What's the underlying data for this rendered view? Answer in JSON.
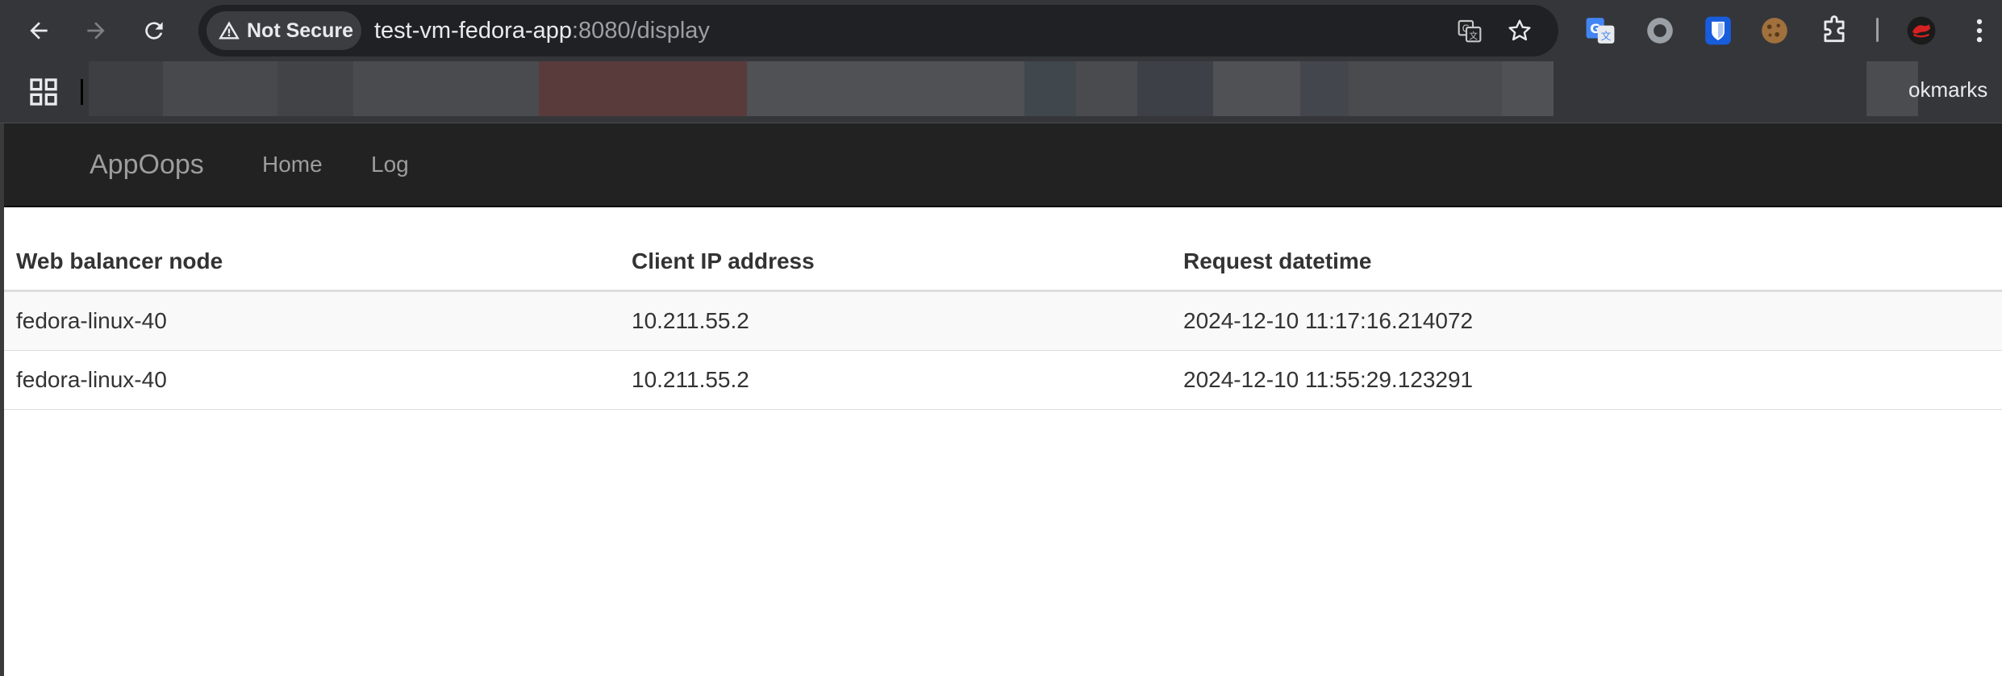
{
  "browser": {
    "security_label": "Not Secure",
    "url_host": "test-vm-fedora-app",
    "url_rest": ":8080/display",
    "bookmarks_label": "okmarks",
    "icons": [
      "back-arrow-icon",
      "forward-arrow-icon",
      "reload-icon",
      "warning-icon",
      "translate-icon",
      "bookmark-star-icon",
      "google-translate-extension-icon",
      "circle-extension-icon",
      "bitwarden-extension-icon",
      "cookie-extension-icon",
      "puzzle-extensions-icon",
      "profile-avatar-icon",
      "more-menu-icon",
      "apps-grid-icon"
    ]
  },
  "site": {
    "brand": "AppOops",
    "nav": {
      "home": "Home",
      "log": "Log"
    }
  },
  "table": {
    "headers": [
      "Web balancer node",
      "Client IP address",
      "Request datetime"
    ],
    "rows": [
      [
        "fedora-linux-40",
        "10.211.55.2",
        "2024-12-10 11:17:16.214072"
      ],
      [
        "fedora-linux-40",
        "10.211.55.2",
        "2024-12-10 11:55:29.123291"
      ]
    ]
  },
  "colors": {
    "chrome_bg": "#35363a",
    "omnibox_bg": "#202124",
    "navbar_bg": "#222222",
    "navbar_text": "#9d9d9d",
    "table_text": "#333333",
    "row_stripe": "#f9f9f9"
  }
}
